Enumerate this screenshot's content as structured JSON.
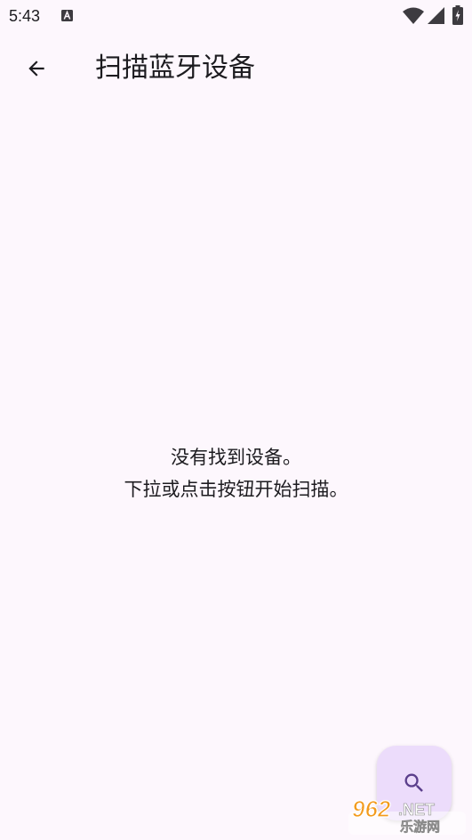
{
  "status_bar": {
    "time": "5:43",
    "notification_icon": "font-a-icon",
    "wifi_icon": "wifi-icon",
    "signal_icon": "cellular-signal-icon",
    "battery_icon": "battery-icon"
  },
  "app_bar": {
    "back_icon": "arrow-back-icon",
    "title": "扫描蓝牙设备"
  },
  "empty_state": {
    "line1": "没有找到设备。",
    "line2": "下拉或点击按钮开始扫描。"
  },
  "fab": {
    "icon": "search-icon"
  },
  "watermark": {
    "text": "962.NET",
    "subtext": "乐游网"
  },
  "colors": {
    "background": "#fdf7fd",
    "fab_background": "#ecdcfb",
    "fab_icon": "#5b3f8c",
    "text": "#1c1b1f",
    "watermark_orange": "#f39a1c"
  }
}
